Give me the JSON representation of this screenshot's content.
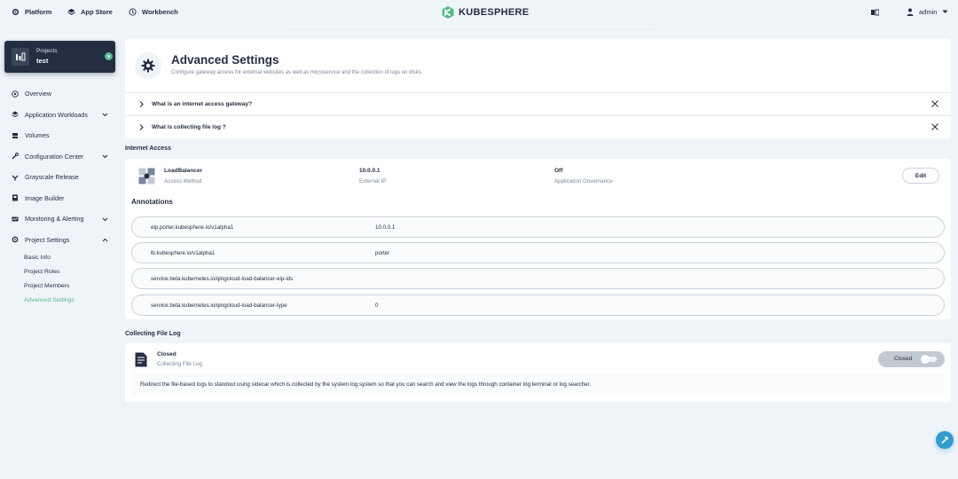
{
  "topnav": {
    "items": [
      {
        "label": "Platform",
        "icon": "gear-icon"
      },
      {
        "label": "App Store",
        "icon": "app-store-icon"
      },
      {
        "label": "Workbench",
        "icon": "workbench-icon"
      }
    ],
    "logo_text": "KUBESPHERE",
    "user": "admin"
  },
  "project": {
    "kind_label": "Projects",
    "name": "test"
  },
  "sidebar": {
    "items": [
      {
        "label": "Overview",
        "icon": "overview-icon",
        "expandable": false
      },
      {
        "label": "Application Workloads",
        "icon": "workloads-icon",
        "expandable": true
      },
      {
        "label": "Volumes",
        "icon": "volumes-icon",
        "expandable": false
      },
      {
        "label": "Configuration Center",
        "icon": "configuration-icon",
        "expandable": true
      },
      {
        "label": "Grayscale Release",
        "icon": "grayscale-icon",
        "expandable": false
      },
      {
        "label": "Image Builder",
        "icon": "image-builder-icon",
        "expandable": false
      },
      {
        "label": "Monitoring & Alerting",
        "icon": "monitoring-icon",
        "expandable": true
      },
      {
        "label": "Project Settings",
        "icon": "settings-icon",
        "expandable": true,
        "expanded": true
      }
    ],
    "subitems": [
      {
        "label": "Basic Info",
        "active": false
      },
      {
        "label": "Project Roles",
        "active": false
      },
      {
        "label": "Project Members",
        "active": false
      },
      {
        "label": "Advanced Settings",
        "active": true
      }
    ]
  },
  "header": {
    "title": "Advanced Settings",
    "description": "Configure gateway access for external websites as well as microservice and the collection of logs on disks."
  },
  "faq": [
    {
      "question": "What is an internet access gateway?"
    },
    {
      "question": "What is collecting file log ?"
    }
  ],
  "internet_access": {
    "section_title": "Internet Access",
    "method_value": "LoadBalancer",
    "method_label": "Access Method",
    "ip_value": "10.0.0.1",
    "ip_label": "External IP",
    "governance_value": "Off",
    "governance_label": "Application Governance",
    "edit_label": "Edit",
    "annotations_title": "Annotations",
    "annotations": [
      {
        "key": "eip.porter.kubesphere.io/v1alpha1",
        "value": "10.0.0.1"
      },
      {
        "key": "lb.kubesphere.io/v1alpha1",
        "value": "porter"
      },
      {
        "key": "service.beta.kubernetes.io/qingcloud-load-balancer-eip-ids",
        "value": ""
      },
      {
        "key": "service.beta.kubernetes.io/qingcloud-load-balancer-type",
        "value": "0"
      }
    ]
  },
  "file_log": {
    "section_title": "Collecting File Log",
    "status": "Closed",
    "status_label": "Collecting File Log",
    "toggle_label": "Closed",
    "description": "Redirect the file-based logs to standout using sidecar which is collected by the system log system so that you can search and view the logs through container log terminal or log searcher."
  },
  "colors": {
    "accent": "#55bc8a",
    "dark": "#242e42",
    "background": "#eff4f9",
    "fab": "#329dce"
  }
}
